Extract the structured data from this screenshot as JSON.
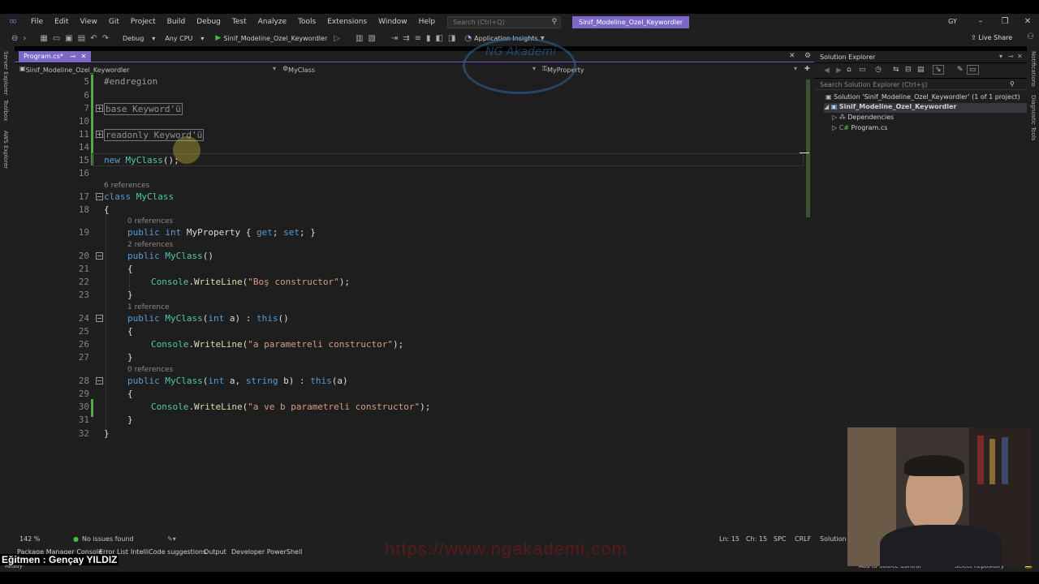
{
  "menu": {
    "items": [
      "File",
      "Edit",
      "View",
      "Git",
      "Project",
      "Build",
      "Debug",
      "Test",
      "Analyze",
      "Tools",
      "Extensions",
      "Window",
      "Help"
    ],
    "search_placeholder": "Search (Ctrl+Q)",
    "solution_name": "Sinif_Modeline_Ozel_Keywordler",
    "avatar": "GY"
  },
  "toolbar": {
    "config": "Debug",
    "platform": "Any CPU",
    "run_target": "Sinif_Modeline_Ozel_Keywordler",
    "insights": "Application Insights",
    "live_share": "Live Share"
  },
  "left_strip": [
    "Server Explorer",
    "Toolbox",
    "AWS Explorer"
  ],
  "right_strip": [
    "Notifications",
    "Diagnostic Tools"
  ],
  "editor": {
    "tab_label": "Program.cs*",
    "nav_project": "Sinif_Modeline_Ozel_Keywordler",
    "nav_class": "MyClass",
    "nav_member": "MyProperty",
    "lines": [
      {
        "n": "5",
        "text": "#endregion"
      },
      {
        "n": "6",
        "text": ""
      },
      {
        "n": "7",
        "text": "base Keyword'ü"
      },
      {
        "n": "10",
        "text": ""
      },
      {
        "n": "11",
        "text": "readonly Keyword'ü"
      },
      {
        "n": "14",
        "text": ""
      },
      {
        "n": "15",
        "text": "new MyClass();"
      },
      {
        "n": "16",
        "text": ""
      },
      {
        "n": "17",
        "text": "class MyClass"
      },
      {
        "n": "18",
        "text": "{"
      },
      {
        "n": "19",
        "text": "public int MyProperty { get; set; }"
      },
      {
        "n": "20",
        "text": "public MyClass()"
      },
      {
        "n": "21",
        "text": "{"
      },
      {
        "n": "22",
        "text": "Console.WriteLine(\"Boş constructor\");"
      },
      {
        "n": "23",
        "text": "}"
      },
      {
        "n": "24",
        "text": "public MyClass(int a) : this()"
      },
      {
        "n": "25",
        "text": "{"
      },
      {
        "n": "26",
        "text": "Console.WriteLine(\"a parametreli constructor\");"
      },
      {
        "n": "27",
        "text": "}"
      },
      {
        "n": "28",
        "text": "public MyClass(int a, string b) : this(a)"
      },
      {
        "n": "29",
        "text": "{"
      },
      {
        "n": "30",
        "text": "Console.WriteLine(\"a ve b parametreli constructor\");"
      },
      {
        "n": "31",
        "text": "}"
      },
      {
        "n": "32",
        "text": "}"
      }
    ],
    "refs": {
      "class": "6 references",
      "prop": "0 references",
      "ctor1": "2 references",
      "ctor2": "1 reference",
      "ctor3": "0 references"
    }
  },
  "solution_explorer": {
    "title": "Solution Explorer",
    "search_placeholder": "Search Solution Explorer (Ctrl+ş)",
    "solution_label": "Solution 'Sinif_Modeline_Ozel_Keywordler' (1 of 1 project)",
    "project": "Sinif_Modeline_Ozel_Keywordler",
    "dependencies": "Dependencies",
    "file": "Program.cs",
    "collapsed_tab": "Solution E"
  },
  "status": {
    "zoom": "142 %",
    "issues": "No issues found",
    "line": "Ln: 15",
    "col": "Ch: 15",
    "spc": "SPC",
    "eol": "CRLF",
    "ready": "Ready",
    "add_source": "Add to Source Control",
    "select_repo": "Select Repository"
  },
  "bottom_tabs": [
    "Package Manager Console",
    "Error List",
    "IntelliCode suggestions",
    "Output",
    "Developer PowerShell"
  ],
  "overlay": {
    "instructor": "Eğitmen : Gençay YILDIZ",
    "watermark": "https://www.ngakademi.com",
    "logo_text": "NG Akademi"
  },
  "colors": {
    "accent": "#7b68c9",
    "keyword": "#569cd6",
    "type": "#4ec9b0",
    "method": "#dcdcaa",
    "string": "#d69d85",
    "change_bar": "#57a64a"
  }
}
